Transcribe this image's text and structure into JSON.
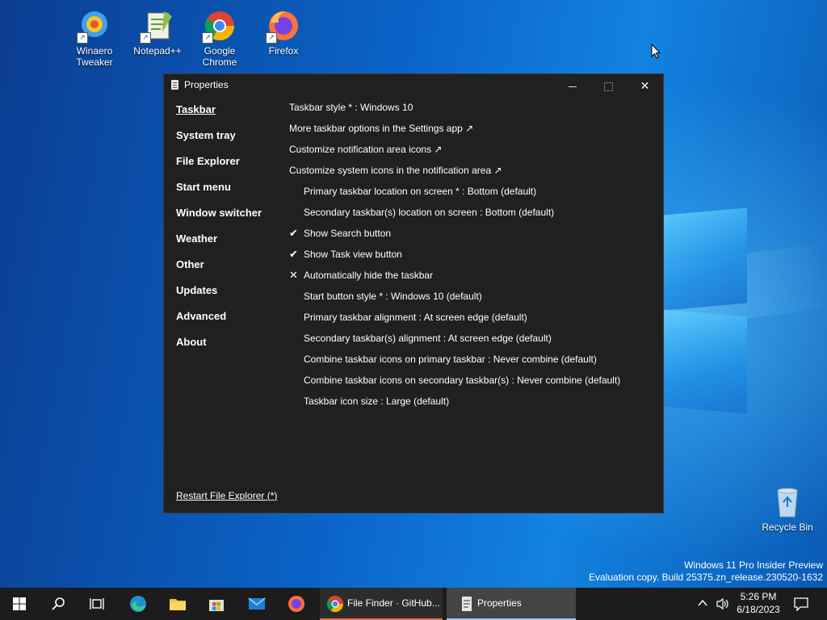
{
  "desktop": {
    "icons": [
      {
        "label": "Winaero Tweaker"
      },
      {
        "label": "Notepad++"
      },
      {
        "label": "Google Chrome"
      },
      {
        "label": "Firefox"
      }
    ],
    "recycle_bin": "Recycle Bin",
    "watermark": {
      "line1": "Windows 11 Pro Insider Preview",
      "line2": "Evaluation copy. Build 25375.zn_release.230520-1632"
    }
  },
  "window": {
    "title": "Properties",
    "nav": [
      {
        "label": "Taskbar",
        "active": true
      },
      {
        "label": "System tray"
      },
      {
        "label": "File Explorer"
      },
      {
        "label": "Start menu"
      },
      {
        "label": "Window switcher"
      },
      {
        "label": "Weather"
      },
      {
        "label": "Other"
      },
      {
        "label": "Updates"
      },
      {
        "label": "Advanced"
      },
      {
        "label": "About"
      }
    ],
    "restart_link": "Restart File Explorer (*)",
    "settings": [
      {
        "label": "Taskbar style * : Windows 10",
        "mark": ""
      },
      {
        "label": "More taskbar options in the Settings app ↗",
        "mark": ""
      },
      {
        "label": "Customize notification area icons ↗",
        "mark": ""
      },
      {
        "label": "Customize system icons in the notification area ↗",
        "mark": ""
      },
      {
        "label": "Primary taskbar location on screen * : Bottom (default)",
        "mark": ""
      },
      {
        "label": "Secondary taskbar(s) location on screen : Bottom (default)",
        "mark": ""
      },
      {
        "label": "Show Search button",
        "mark": "✔"
      },
      {
        "label": "Show Task view button",
        "mark": "✔"
      },
      {
        "label": "Automatically hide the taskbar",
        "mark": "✕"
      },
      {
        "label": "Start button style * : Windows 10 (default)",
        "mark": ""
      },
      {
        "label": "Primary taskbar alignment : At screen edge (default)",
        "mark": ""
      },
      {
        "label": "Secondary taskbar(s) alignment : At screen edge (default)",
        "mark": ""
      },
      {
        "label": "Combine taskbar icons on primary taskbar : Never combine (default)",
        "mark": ""
      },
      {
        "label": "Combine taskbar icons on secondary taskbar(s) : Never combine (default)",
        "mark": ""
      },
      {
        "label": "Taskbar icon size : Large (default)",
        "mark": ""
      }
    ]
  },
  "taskbar": {
    "apps": [
      {
        "label": "File Finder · GitHub..."
      },
      {
        "label": "Properties"
      }
    ],
    "time": "5:26 PM",
    "date": "6/18/2023"
  },
  "colors": {
    "window_bg": "#202020",
    "taskbar_bg": "#1c1c1c",
    "desktop_blue": "#0a64c8"
  }
}
